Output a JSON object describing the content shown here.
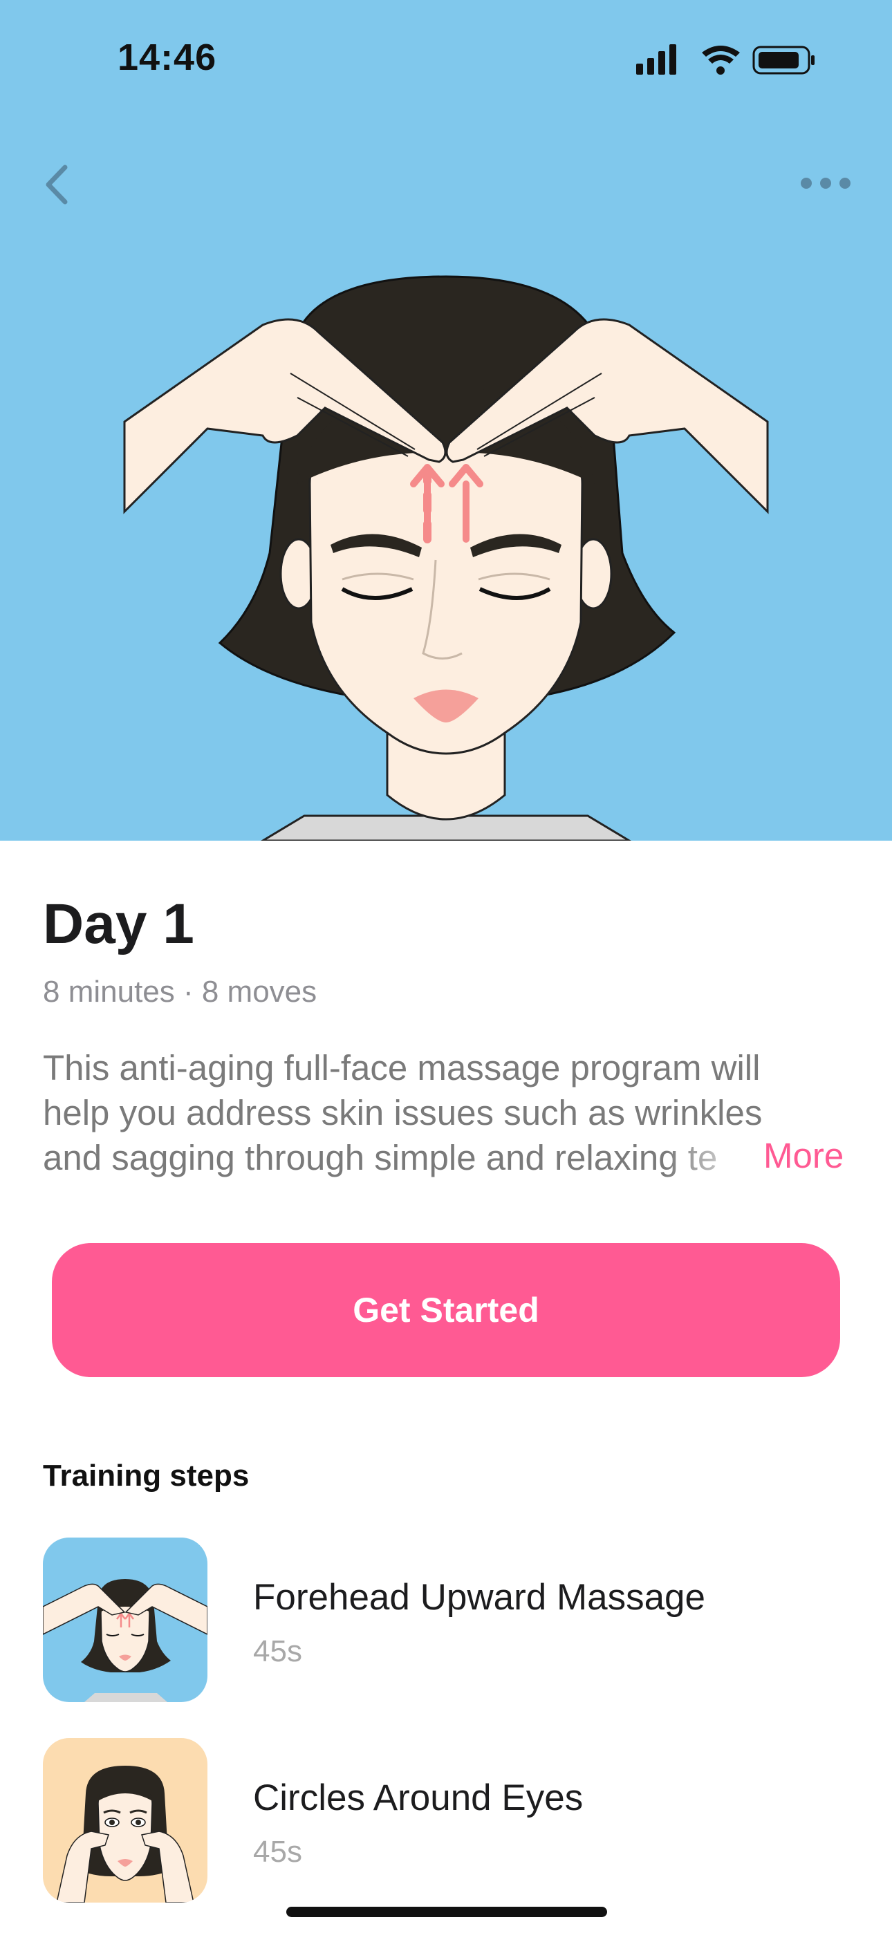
{
  "status_bar": {
    "time": "14:46"
  },
  "icons": {
    "back": "chevron-left-icon",
    "more": "ellipsis-icon",
    "signal": "cellular-signal-icon",
    "wifi": "wifi-icon",
    "battery": "battery-icon"
  },
  "colors": {
    "hero_bg": "#80c8ec",
    "accent": "#ff5a93",
    "thumb_2_bg": "#fcdcb0"
  },
  "program": {
    "title": "Day 1",
    "meta": "8 minutes · 8 moves",
    "description_lines": [
      "This anti-aging full-face massage program will",
      "help you address skin issues such as wrinkles",
      "and sagging through simple and relaxing te"
    ],
    "more_label": "More"
  },
  "cta": {
    "label": "Get Started"
  },
  "training": {
    "heading": "Training steps",
    "steps": [
      {
        "title": "Forehead Upward Massage",
        "duration": "45s"
      },
      {
        "title": "Circles Around Eyes",
        "duration": "45s"
      }
    ]
  }
}
